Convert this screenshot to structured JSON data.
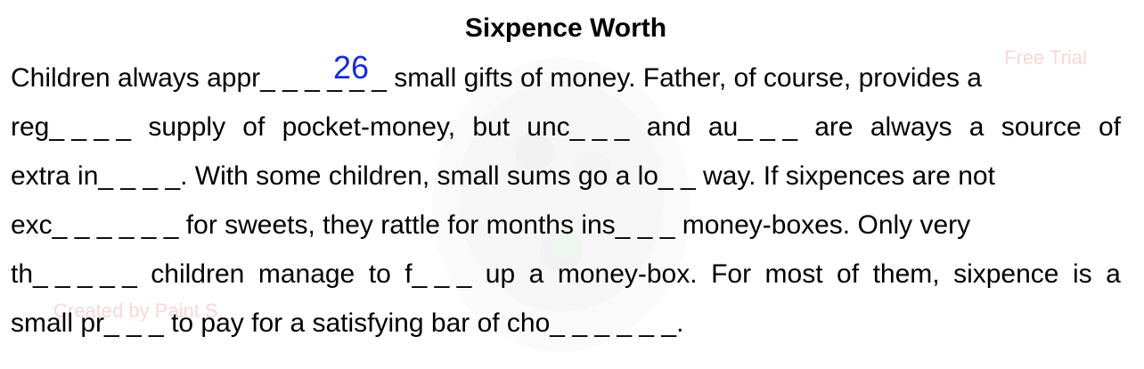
{
  "title": "Sixpence Worth",
  "answer_number": "26",
  "watermarks": {
    "trial": "Free Trial",
    "created": "Created by Paint S"
  },
  "lines": {
    "l1": "Children always appr_ _ _ _ _ _ small gifts of money. Father, of course, provides a",
    "l2": [
      "reg_ _ _ _",
      "supply",
      "of",
      "pocket-money,",
      "but",
      "unc_ _ _",
      "and",
      "au_ _ _",
      "are",
      "always",
      "a",
      "source",
      "of"
    ],
    "l3": "extra in_ _ _ _. With some children, small sums go a lo_ _ way. If sixpences are not",
    "l4": "exc_ _ _ _ _ _ for sweets, they rattle for months ins_ _ _ money-boxes. Only very",
    "l5": [
      "th_ _ _ _ _",
      "children",
      "manage",
      "to",
      "f_ _ _",
      "up",
      "a",
      "money-box.",
      "For",
      "most",
      "of",
      "them,",
      "sixpence",
      "is",
      "a"
    ],
    "l6": "small pr_ _ _ to pay for a satisfying bar of cho_ _ _ _ _ _."
  }
}
